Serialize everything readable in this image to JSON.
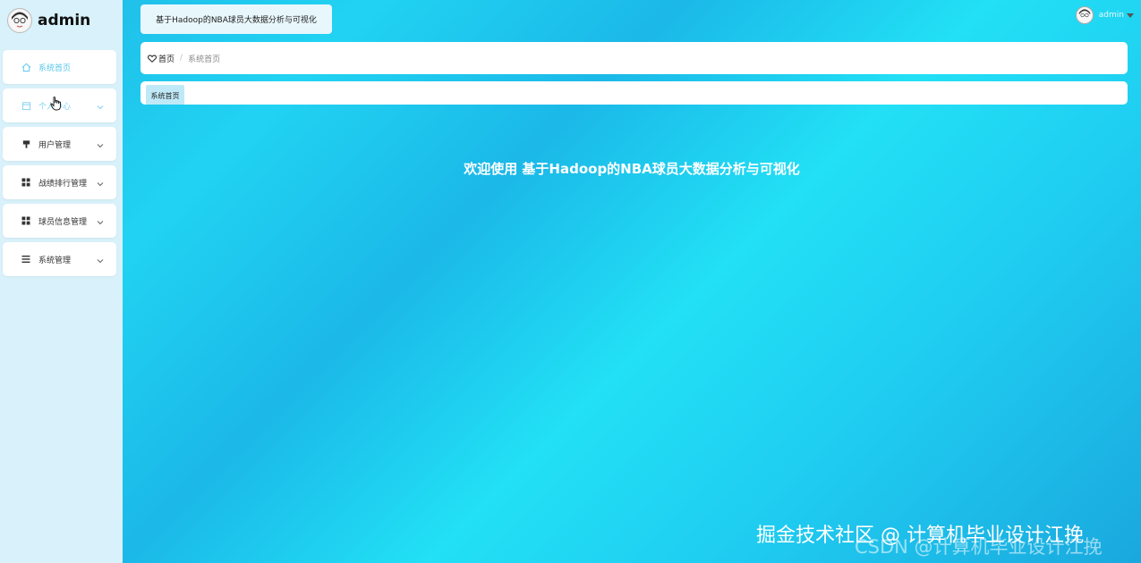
{
  "app": {
    "brand_name": "admin",
    "title_tab": "基于Hadoop的NBA球员大数据分析与可视化"
  },
  "user": {
    "name": "admin"
  },
  "sidebar": {
    "items": [
      {
        "label": "系统首页",
        "icon": "home-icon",
        "state": "active"
      },
      {
        "label": "个人中心",
        "icon": "calendar-icon",
        "state": "dim"
      },
      {
        "label": "用户管理",
        "icon": "pin-icon",
        "state": "normal"
      },
      {
        "label": "战绩排行管理",
        "icon": "grid-icon",
        "state": "normal"
      },
      {
        "label": "球员信息管理",
        "icon": "grid-icon",
        "state": "normal"
      },
      {
        "label": "系统管理",
        "icon": "list-icon",
        "state": "normal"
      }
    ]
  },
  "breadcrumb": {
    "home": "首页",
    "current": "系统首页"
  },
  "tags": {
    "active": "系统首页"
  },
  "main": {
    "welcome": "欢迎使用 基于Hadoop的NBA球员大数据分析与可视化"
  },
  "watermark": {
    "front": "掘金技术社区 @ 计算机毕业设计江挽",
    "back": "CSDN @计算机毕业设计江挽"
  },
  "colors": {
    "accent": "#58c7ea",
    "sidebar_bg": "#d8f1fa"
  }
}
